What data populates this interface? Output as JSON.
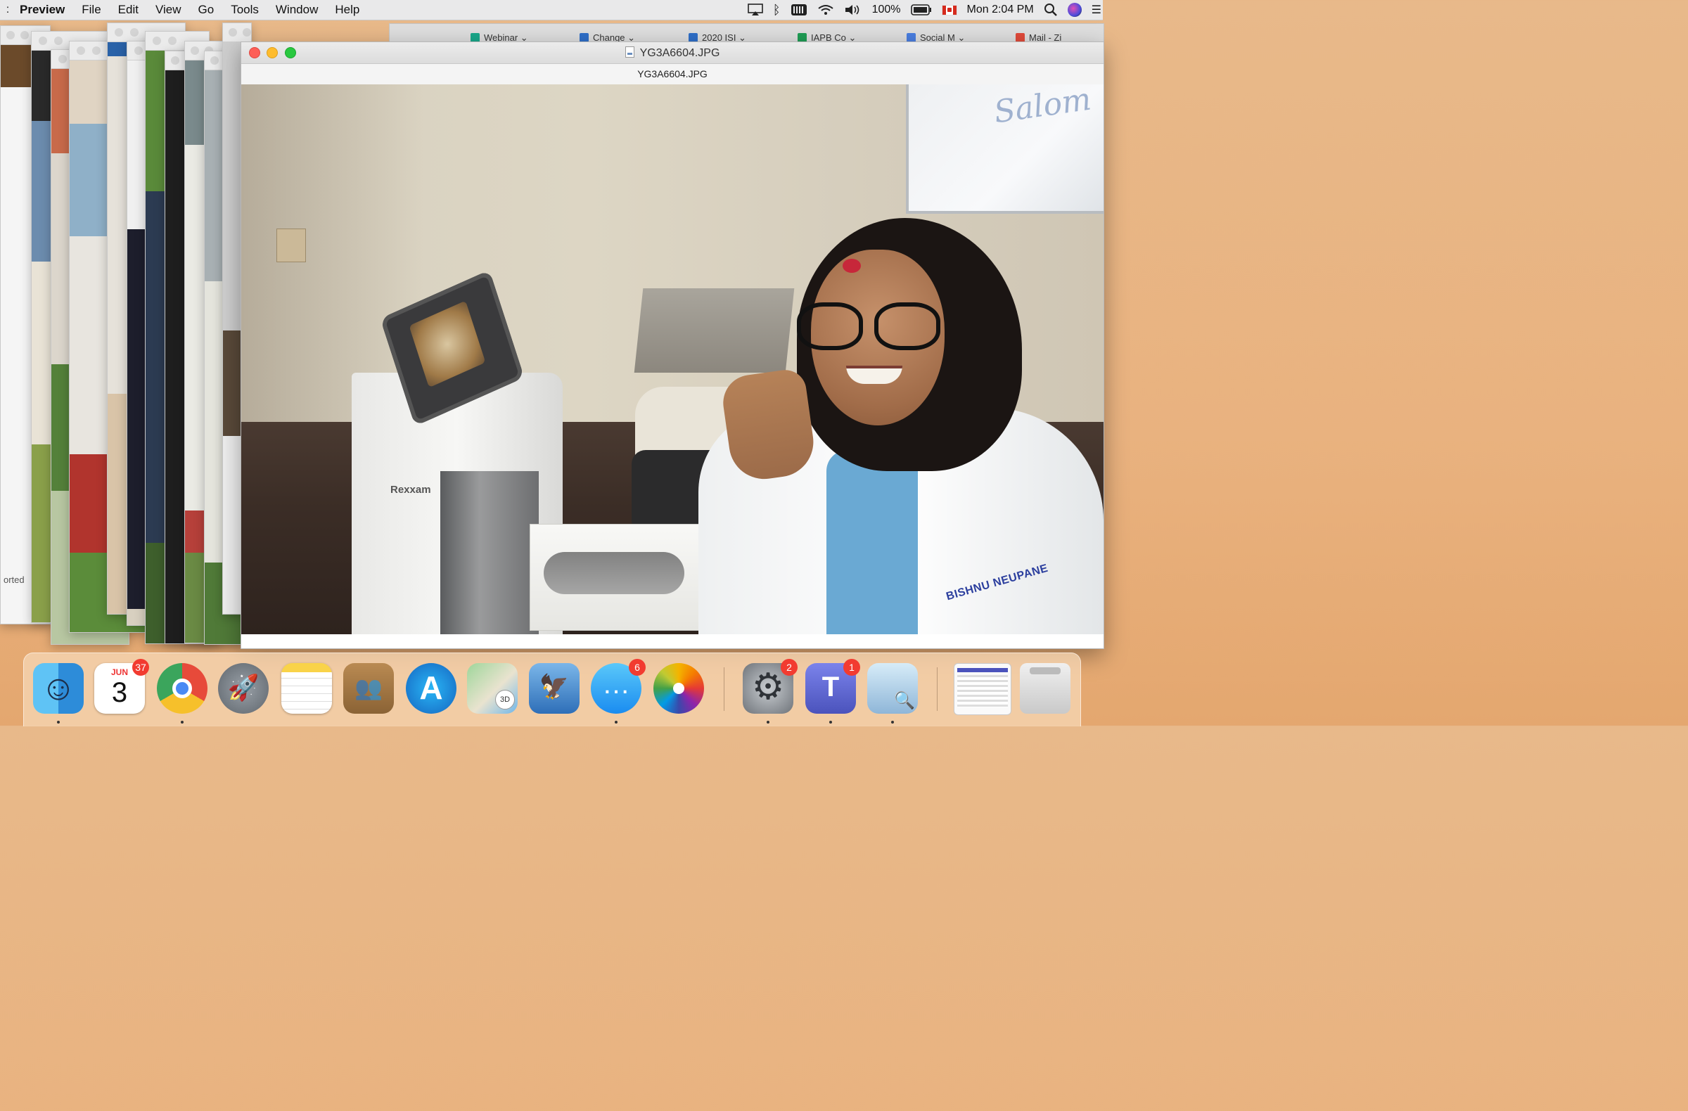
{
  "menubar": {
    "app_name": "Preview",
    "items": [
      "File",
      "Edit",
      "View",
      "Go",
      "Tools",
      "Window",
      "Help"
    ],
    "status": {
      "battery": "100%",
      "clock": "Mon 2:04 PM"
    }
  },
  "browser": {
    "tabs": [
      "Webinar",
      "Change",
      "2020 ISI",
      "IAPB Co",
      "Social M",
      "Mail - Zi"
    ]
  },
  "background_window": {
    "text_fragment": "orted"
  },
  "preview_window": {
    "title": "YG3A6604.JPG",
    "subtitle": "YG3A6604.JPG",
    "photo": {
      "whiteboard_text": "Salom",
      "device_brand": "Rexxam",
      "coat_name": "BISHNU NEUPANE"
    }
  },
  "dock": {
    "calendar": {
      "month": "JUN",
      "day": "3"
    },
    "items": [
      {
        "name": "finder",
        "badge": null
      },
      {
        "name": "calendar",
        "badge": "37"
      },
      {
        "name": "chrome",
        "badge": null
      },
      {
        "name": "launchpad",
        "badge": null
      },
      {
        "name": "notes",
        "badge": null
      },
      {
        "name": "contacts",
        "badge": null
      },
      {
        "name": "app-store",
        "badge": null
      },
      {
        "name": "maps",
        "badge": null
      },
      {
        "name": "mail",
        "badge": null
      },
      {
        "name": "messages",
        "badge": "6"
      },
      {
        "name": "photos",
        "badge": null
      },
      {
        "name": "system-preferences",
        "badge": "2"
      },
      {
        "name": "teams",
        "badge": "1"
      },
      {
        "name": "preview",
        "badge": null
      },
      {
        "name": "minimized-window",
        "badge": null
      },
      {
        "name": "trash",
        "badge": null
      }
    ]
  },
  "colors": {
    "close": "#fd5f57",
    "minimize": "#febc2e",
    "zoom": "#29c840",
    "badge": "#f23b30"
  }
}
